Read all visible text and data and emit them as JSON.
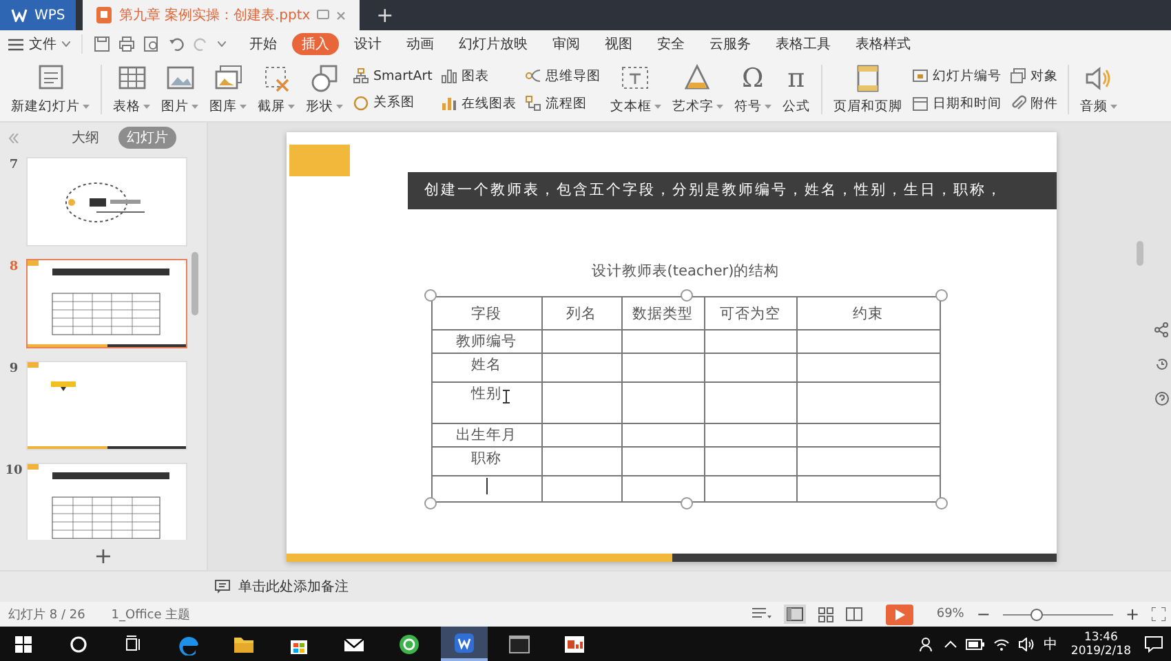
{
  "title_bar": {
    "tabs": [
      {
        "label": "WPS",
        "selected": false
      },
      {
        "label": "第九章 案例实操：创建表.pptx",
        "selected": true
      }
    ],
    "new_tab": "+"
  },
  "menu": {
    "file": "文件",
    "items": [
      {
        "label": "开始",
        "selected": false
      },
      {
        "label": "插入",
        "selected": true
      },
      {
        "label": "设计",
        "selected": false
      },
      {
        "label": "动画",
        "selected": false
      },
      {
        "label": "幻灯片放映",
        "selected": false
      },
      {
        "label": "审阅",
        "selected": false
      },
      {
        "label": "视图",
        "selected": false
      },
      {
        "label": "安全",
        "selected": false
      },
      {
        "label": "云服务",
        "selected": false
      },
      {
        "label": "表格工具",
        "selected": false
      },
      {
        "label": "表格样式",
        "selected": false
      }
    ]
  },
  "ribbon": [
    {
      "kind": "large",
      "label": "新建幻灯片",
      "dropdown": true
    },
    {
      "kind": "divider"
    },
    {
      "kind": "large",
      "label": "表格",
      "dropdown": true
    },
    {
      "kind": "large",
      "label": "图片",
      "dropdown": true
    },
    {
      "kind": "large",
      "label": "图库",
      "dropdown": true
    },
    {
      "kind": "large",
      "label": "截屏",
      "dropdown": true
    },
    {
      "kind": "large",
      "label": "形状",
      "dropdown": true
    },
    {
      "kind": "stack",
      "items": [
        {
          "label": "SmartArt"
        },
        {
          "label": "关系图"
        }
      ]
    },
    {
      "kind": "stack",
      "items": [
        {
          "label": "图表"
        },
        {
          "label": "在线图表"
        }
      ]
    },
    {
      "kind": "stack",
      "items": [
        {
          "label": "思维导图"
        },
        {
          "label": "流程图"
        }
      ]
    },
    {
      "kind": "large",
      "label": "文本框",
      "dropdown": true
    },
    {
      "kind": "large",
      "label": "艺术字",
      "dropdown": true
    },
    {
      "kind": "glyph",
      "glyph": "Ω",
      "label": "符号",
      "dropdown": true
    },
    {
      "kind": "glyph",
      "glyph": "π",
      "label": "公式",
      "dropdown": false
    },
    {
      "kind": "divider"
    },
    {
      "kind": "large",
      "label": "页眉和页脚",
      "dropdown": false
    },
    {
      "kind": "stack",
      "items": [
        {
          "label": "幻灯片编号"
        },
        {
          "label": "日期和时间"
        }
      ]
    },
    {
      "kind": "stack",
      "items": [
        {
          "label": "对象"
        },
        {
          "label": "附件"
        }
      ]
    },
    {
      "kind": "divider"
    },
    {
      "kind": "large",
      "label": "音频",
      "dropdown": true
    }
  ],
  "panel": {
    "tabs": [
      {
        "label": "大纲",
        "selected": false
      },
      {
        "label": "幻灯片",
        "selected": true
      }
    ],
    "slides": [
      {
        "number": "7",
        "kind": "diagram",
        "selected": false
      },
      {
        "number": "8",
        "kind": "table",
        "selected": true
      },
      {
        "number": "9",
        "kind": "label",
        "selected": false
      },
      {
        "number": "10",
        "kind": "table",
        "selected": false
      }
    ],
    "add": "+"
  },
  "slide": {
    "banner": "创建一个教师表，包含五个字段，分别是教师编号，姓名，性别，生日，职称，",
    "caption": "设计教师表(teacher)的结构",
    "table": {
      "selected": true,
      "columns": [
        "字段",
        "列名",
        "数据类型",
        "可否为空",
        "约束"
      ],
      "rows": [
        {
          "field": "教师编号",
          "cursor": false
        },
        {
          "field": "姓名",
          "cursor": false
        },
        {
          "field": "性别",
          "cursor": false
        },
        {
          "field": "出生年月",
          "cursor": false
        },
        {
          "field": "职称",
          "cursor": false
        },
        {
          "cursor": true
        }
      ]
    }
  },
  "notes": "单击此处添加备注",
  "status_bar": {
    "slide_counter": "幻灯片 8 / 26",
    "theme": "1_Office 主题",
    "zoom": "69%",
    "minus": "−",
    "plus": "+",
    "zoom_slider": {
      "level": 0.3
    }
  },
  "taskbar": {
    "apps": [
      {
        "selected": false
      },
      {
        "selected": false
      },
      {
        "selected": false
      },
      {
        "selected": false
      },
      {
        "selected": false
      },
      {
        "selected": false
      },
      {
        "selected": false
      },
      {
        "selected": true
      },
      {
        "selected": false
      },
      {
        "selected": false
      }
    ],
    "ime": "中",
    "time": "13:46",
    "date": "2019/2/18"
  }
}
